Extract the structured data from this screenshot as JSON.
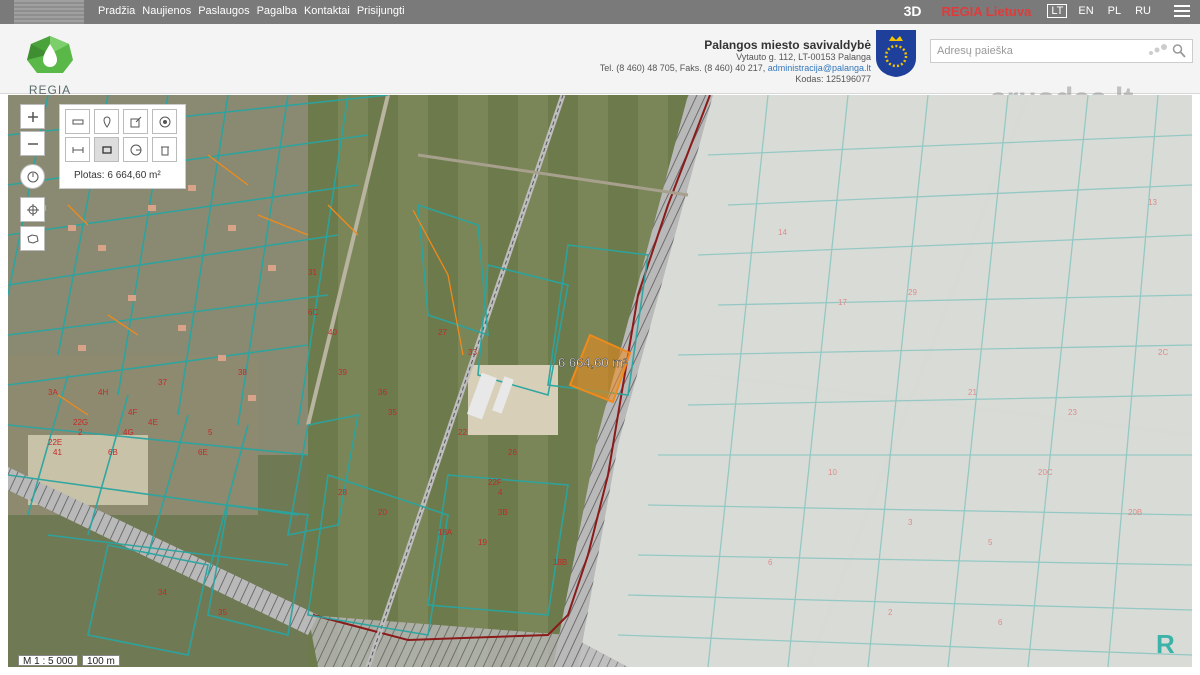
{
  "nav": {
    "items": [
      "Pradžia",
      "Naujienos",
      "Paslaugos",
      "Pagalba",
      "Kontaktai",
      "Prisijungti"
    ]
  },
  "topright": {
    "btn3d": "3D",
    "regia": "REGIA Lietuva",
    "langs": [
      "LT",
      "EN",
      "PL",
      "RU"
    ],
    "active_lang": "LT"
  },
  "logo": {
    "text": "REGIA"
  },
  "municipality": {
    "name": "Palangos miesto savivaldybė",
    "address": "Vytauto g. 112, LT-00153 Palanga",
    "phone_prefix": "Tel. (8 460) 48 705, Faks. (8 460) 40 217, ",
    "email": "administracija@palanga.lt",
    "code": "Kodas: 125196077"
  },
  "search": {
    "placeholder": "Adresų paieška"
  },
  "watermark": "aruodas.lt",
  "map": {
    "area_label": "Plotas: 6 664,60 m²",
    "measure_label": "6 664,60 m²",
    "scale_text": "M 1 : 5 000",
    "scale_bar": "100 m",
    "parcel_numbers": [
      "3A",
      "37",
      "38",
      "31",
      "27",
      "33",
      "22",
      "4",
      "26",
      "28",
      "20",
      "18A",
      "19",
      "18B",
      "3B",
      "22F",
      "22E",
      "22G",
      "2",
      "41",
      "4H",
      "4F",
      "4E",
      "4G",
      "6B",
      "6E",
      "5",
      "6C",
      "40",
      "39",
      "36",
      "35",
      "34",
      "35",
      "6",
      "10",
      "3",
      "5",
      "20C",
      "20B",
      "14",
      "17",
      "29",
      "21",
      "23",
      "2",
      "6",
      "13",
      "2C"
    ],
    "colors": {
      "parcel": "#2aa5a0",
      "highlight": "#f08a1a",
      "boundary": "#8b1a1a",
      "number": "#c62828"
    }
  }
}
